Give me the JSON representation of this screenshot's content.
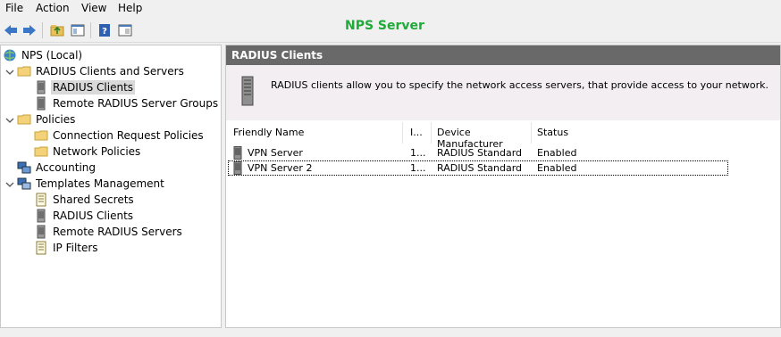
{
  "menu": {
    "file": "File",
    "action": "Action",
    "view": "View",
    "help": "Help"
  },
  "app_title": "NPS Server",
  "toolbar": {
    "buttons": [
      "back-arrow-icon",
      "forward-arrow-icon",
      "up-folder-icon",
      "show-hide-tree-icon",
      "help-icon",
      "properties-icon"
    ]
  },
  "tree": {
    "root": "NPS (Local)",
    "radius_clients_servers": "RADIUS Clients and Servers",
    "radius_clients": "RADIUS Clients",
    "remote_groups": "Remote RADIUS Server Groups",
    "policies": "Policies",
    "connection_request": "Connection Request Policies",
    "network_policies": "Network Policies",
    "accounting": "Accounting",
    "templates": "Templates Management",
    "shared_secrets": "Shared Secrets",
    "t_radius_clients": "RADIUS Clients",
    "t_remote_servers": "Remote RADIUS Servers",
    "ip_filters": "IP Filters"
  },
  "right": {
    "header": "RADIUS Clients",
    "description": "RADIUS clients allow you to specify the network access servers, that provide access to your network."
  },
  "table": {
    "columns": [
      "Friendly Name",
      "I...",
      "Device Manufacturer",
      "Status"
    ],
    "rows": [
      {
        "name": "VPN Server",
        "ip": "1...",
        "manufacturer": "RADIUS Standard",
        "status": "Enabled"
      },
      {
        "name": "VPN Server 2",
        "ip": "1...",
        "manufacturer": "RADIUS Standard",
        "status": "Enabled"
      }
    ]
  },
  "colors": {
    "title_green": "#1faa3a",
    "header_gray": "#696969",
    "desc_bg": "#f2eef2"
  }
}
